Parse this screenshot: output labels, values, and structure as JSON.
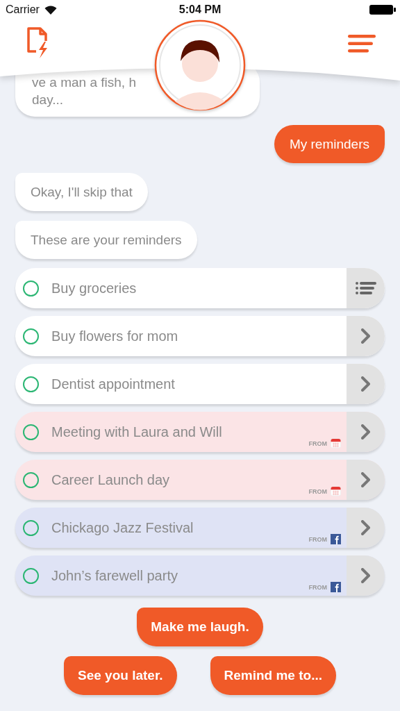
{
  "status_bar": {
    "carrier": "Carrier",
    "time": "5:04 PM"
  },
  "messages": [
    {
      "kind": "bot",
      "lines": [
        "ve a man a fish, h",
        "day..."
      ]
    },
    {
      "kind": "user",
      "lines": [
        "My reminders"
      ]
    },
    {
      "kind": "bot",
      "lines": [
        "Okay, I'll skip that"
      ]
    },
    {
      "kind": "bot",
      "lines": [
        "These are your reminders"
      ]
    }
  ],
  "reminders": [
    {
      "title": "Buy groceries",
      "checked": false,
      "kind": "list",
      "color": "#ffffff"
    },
    {
      "title": "Buy flowers for mom",
      "checked": false,
      "kind": "plain",
      "color": "#ffffff"
    },
    {
      "title": "Dentist appointment",
      "checked": false,
      "kind": "plain",
      "color": "#ffffff"
    },
    {
      "title": "Meeting with Laura and Will",
      "checked": false,
      "kind": "calendar",
      "color": "#fbe4e6",
      "from_label": "FROM"
    },
    {
      "title": "Career Launch day",
      "checked": false,
      "kind": "calendar",
      "color": "#fbe4e6",
      "from_label": "FROM"
    },
    {
      "title": "Chickago Jazz Festival",
      "checked": false,
      "kind": "facebook",
      "color": "#dfe3f5",
      "from_label": "FROM"
    },
    {
      "title": "John’s farewell party",
      "checked": false,
      "kind": "facebook",
      "color": "#dfe3f5",
      "from_label": "FROM"
    }
  ],
  "quick_replies": [
    [
      "Make me laugh."
    ],
    [
      "See you later.",
      "Remind me to..."
    ]
  ]
}
